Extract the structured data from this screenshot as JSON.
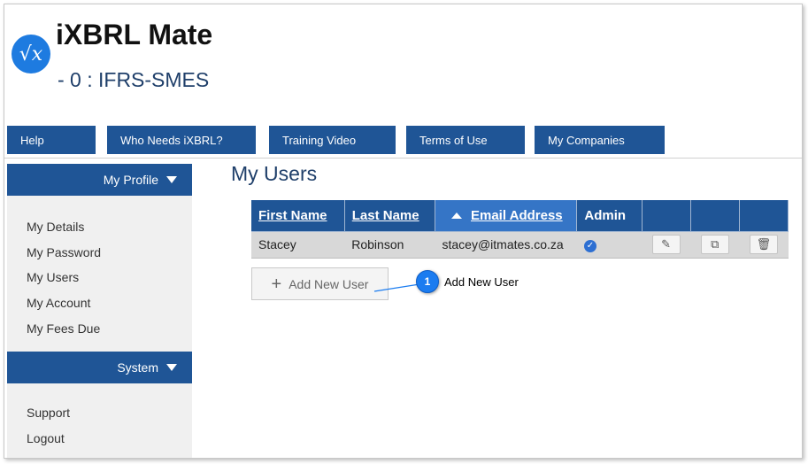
{
  "app": {
    "title": "iXBRL Mate",
    "subtitle": "- 0 : IFRS-SMES",
    "logo_glyph": "√x",
    "logo_icon": "square-root-x-logo",
    "accent_color": "#1f5596"
  },
  "topnav": {
    "items": [
      {
        "label": "Help"
      },
      {
        "label": "Who Needs iXBRL?"
      },
      {
        "label": "Training Video"
      },
      {
        "label": "Terms of Use"
      },
      {
        "label": "My Companies"
      }
    ]
  },
  "sidebar": {
    "profile": {
      "heading": "My Profile",
      "items": [
        {
          "label": "My Details"
        },
        {
          "label": "My Password"
        },
        {
          "label": "My Users"
        },
        {
          "label": "My Account"
        },
        {
          "label": "My Fees Due"
        }
      ]
    },
    "system": {
      "heading": "System",
      "items": [
        {
          "label": "Support"
        },
        {
          "label": "Logout"
        }
      ]
    }
  },
  "main": {
    "title": "My Users",
    "table": {
      "columns": [
        "First Name",
        "Last Name",
        "Email Address",
        "Admin"
      ],
      "sorted_column": "Email Address",
      "sort_direction": "ascending",
      "rows": [
        {
          "first_name": "Stacey",
          "last_name": "Robinson",
          "email": "stacey@itmates.co.za",
          "admin": true
        }
      ],
      "row_actions": [
        "pencil-icon",
        "copy-icon",
        "trash-icon"
      ]
    },
    "add_button": {
      "label": "Add New User",
      "icon": "plus-icon"
    }
  },
  "callout": {
    "number": "1",
    "text": "Add New User",
    "color": "#1b7cf0"
  }
}
